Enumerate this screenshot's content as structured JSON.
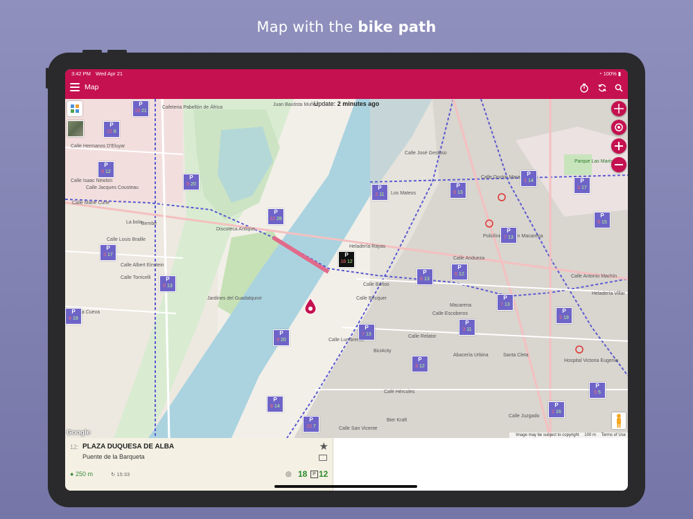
{
  "caption": {
    "prefix": "Map with the",
    "bold": "bike path"
  },
  "status_bar": {
    "time": "3:42 PM",
    "date": "Wed Apr 21",
    "battery": "100%"
  },
  "app_bar": {
    "title": "Map",
    "icons": [
      "menu-icon",
      "timer-icon",
      "refresh-icon",
      "search-icon"
    ]
  },
  "map": {
    "update_prefix": "Update:",
    "update_value": "2 minutes ago",
    "streets": [
      "Calle Torricelli",
      "Calle Hermanos D'Eluyar",
      "Calle Isaac Newton",
      "Calle Jacques Cousteau",
      "Calle Marie Curie",
      "La bola",
      "Bembe",
      "Calle Louis Braille",
      "Calle Albert Einstein",
      "La Cueva",
      "Cafeteria Pabellón de África",
      "Juan Bautista Muñoz",
      "Discoteca Antique",
      "Jardines del Guadalquivir",
      "Heladería Rayas",
      "Calle Baños",
      "Calle Becquer",
      "Calle Escoberos",
      "Macarena",
      "Calle Lumbreras",
      "Bici4city",
      "Abacería Urbina",
      "Santa Cleta",
      "Café Hércules",
      "Bier Kraft",
      "Los Mateos",
      "Calle Doctor Marañón",
      "Policlínico Virgen Macarena",
      "Calle Andueza",
      "Calle Antonio Machín",
      "Heladería Villar",
      "Hospital Victoria Eugenia",
      "Parque Las Marismas",
      "Calle Juzgado",
      "Calle San Vicente",
      "Calle José Gestoso",
      "Calle Relator"
    ],
    "attribution": {
      "image_note": "Image may be subject to copyright",
      "scale": "100 m",
      "terms": "Terms of Use"
    },
    "google": "Google",
    "stations": [
      {
        "top": "P",
        "a": "19",
        "b": "21"
      },
      {
        "top": "P",
        "a": "12",
        "b": "8"
      },
      {
        "top": "P",
        "a": "8",
        "b": "12"
      },
      {
        "top": "P",
        "a": "9",
        "b": "20"
      },
      {
        "top": "P",
        "a": "12",
        "b": "28"
      },
      {
        "top": "P",
        "a": "3",
        "b": "17"
      },
      {
        "top": "P",
        "a": "5",
        "b": "13"
      },
      {
        "top": "P",
        "a": "4",
        "b": "19"
      },
      {
        "top": "P",
        "a": "9",
        "b": "20"
      },
      {
        "top": "P",
        "a": "18",
        "b": "12"
      },
      {
        "top": "P",
        "a": "2",
        "b": "11"
      },
      {
        "top": "P",
        "a": "6",
        "b": "13"
      },
      {
        "top": "P",
        "a": "1",
        "b": "14"
      },
      {
        "top": "P",
        "a": "3",
        "b": "17"
      },
      {
        "top": "P",
        "a": "7",
        "b": "13"
      },
      {
        "top": "P",
        "a": "5",
        "b": "15"
      },
      {
        "top": "P",
        "a": "8",
        "b": "13"
      },
      {
        "top": "P",
        "a": "6",
        "b": "12"
      },
      {
        "top": "P",
        "a": "7",
        "b": "13"
      },
      {
        "top": "P",
        "a": "3",
        "b": "11"
      },
      {
        "top": "P",
        "a": "5",
        "b": "19"
      },
      {
        "top": "P",
        "a": "7",
        "b": "13"
      },
      {
        "top": "P",
        "a": "3",
        "b": "12"
      },
      {
        "top": "P",
        "a": "10",
        "b": "7"
      },
      {
        "top": "P",
        "a": "8",
        "b": "14"
      },
      {
        "top": "P",
        "a": "9",
        "b": "5"
      },
      {
        "top": "P",
        "a": "2",
        "b": "16"
      }
    ]
  },
  "panel": {
    "number": "12:",
    "name": "PLAZA DUQUESA DE ALBA",
    "subtitle": "Puente de la Barqueta",
    "distance": "250 m",
    "updated": "15:33",
    "bikes": "18",
    "parkings": "12"
  }
}
